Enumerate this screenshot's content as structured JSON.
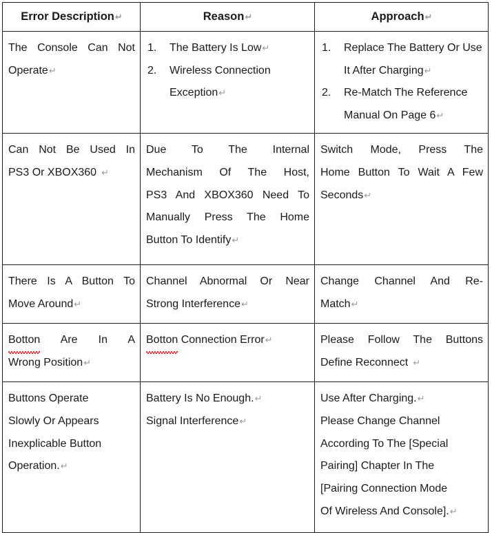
{
  "document": {
    "type": "troubleshooting-table",
    "paragraph_mark": "↵",
    "spellcheck_underline_color": "#e02b2b",
    "border_color": "#1a1a1a",
    "background_color": "#ffffff"
  },
  "table": {
    "headers": {
      "col1": "Error Description",
      "col2": "Reason",
      "col3": "Approach"
    },
    "rows": [
      {
        "id": "row-1",
        "error_description": {
          "lines": [
            "The Console Can Not",
            "Operate"
          ],
          "align": "justify"
        },
        "reason": {
          "type": "ordered-list",
          "items": [
            {
              "num": "1.",
              "text": "The Battery Is Low",
              "mark": true
            },
            {
              "num": "2.",
              "text": "Wireless Connection Exception",
              "mark": true
            }
          ]
        },
        "approach": {
          "type": "ordered-list",
          "items": [
            {
              "num": "1.",
              "text": "Replace The Battery Or Use It After Charging",
              "mark": true
            },
            {
              "num": "2.",
              "text": "Re-Match The Reference Manual On Page 6",
              "mark": true
            }
          ]
        }
      },
      {
        "id": "row-2",
        "error_description": {
          "lines": [
            "Can Not Be Used In",
            "PS3 Or XBOX360"
          ],
          "align": "justify"
        },
        "reason": {
          "type": "paragraph",
          "lines": [
            "Due To The Internal",
            "Mechanism Of The Host,",
            "PS3 And XBOX360 Need To",
            "Manually Press The Home",
            "Button To Identify"
          ],
          "align": "justify"
        },
        "approach": {
          "type": "paragraph",
          "lines": [
            "Switch Mode, Press The",
            "Home Button To Wait A Few",
            "Seconds"
          ],
          "align": "justify"
        }
      },
      {
        "id": "row-3",
        "error_description": {
          "lines": [
            "There Is A Button To",
            "Move Around"
          ],
          "align": "justify"
        },
        "reason": {
          "type": "paragraph",
          "lines": [
            "Channel Abnormal Or Near",
            "Strong Interference"
          ],
          "align": "justify"
        },
        "approach": {
          "type": "paragraph",
          "lines": [
            "Change Channel And Re-",
            "Match"
          ],
          "align": "justify"
        }
      },
      {
        "id": "row-4",
        "error_description": {
          "misspelled_word": "Botton",
          "lines": [
            "Are In A",
            "Wrong Position"
          ],
          "align": "justify"
        },
        "reason": {
          "misspelled_word": "Botton",
          "text": "Connection Error",
          "align": "left"
        },
        "approach": {
          "type": "paragraph",
          "lines": [
            "Please Follow The Buttons",
            "Define Reconnect"
          ],
          "align": "justify"
        }
      },
      {
        "id": "row-5",
        "error_description": {
          "lines": [
            "Buttons Operate",
            "Slowly Or Appears",
            "Inexplicable Button",
            "Operation."
          ],
          "align": "left"
        },
        "reason": {
          "type": "paragraph",
          "lines": [
            "Battery Is No Enough.",
            "Signal Interference"
          ],
          "align": "left",
          "marks_per_line": [
            true,
            true
          ]
        },
        "approach": {
          "type": "paragraph",
          "lines": [
            "Use After Charging.",
            "Please Change Channel",
            "According To The [Special",
            "Pairing] Chapter In The",
            "[Pairing Connection Mode",
            "Of Wireless And Console]."
          ],
          "align": "left",
          "marks_per_line": [
            true,
            false,
            false,
            false,
            false,
            true
          ]
        }
      }
    ]
  }
}
